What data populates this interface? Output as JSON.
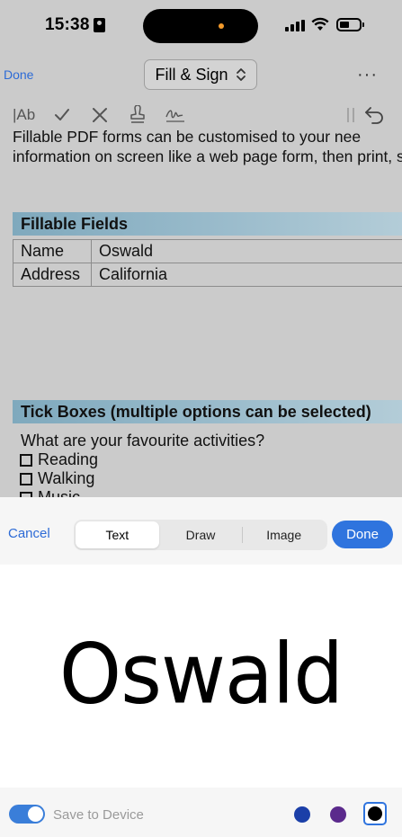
{
  "status_bar": {
    "time": "15:38"
  },
  "nav": {
    "done_label": "Done",
    "mode_label": "Fill & Sign",
    "more_label": "···"
  },
  "toolbar": {
    "text_tool_label": "|Ab"
  },
  "document": {
    "intro_line_1": "Fillable PDF forms can be customised to your nee",
    "intro_line_2": "information on screen like a web page form, then print, s",
    "fillable_header": "Fillable Fields",
    "fields": [
      {
        "label": "Name",
        "value": "Oswald"
      },
      {
        "label": "Address",
        "value": "California"
      }
    ],
    "tick_header": "Tick Boxes (multiple options can be selected)",
    "question": "What are your favourite activities?",
    "options": [
      "Reading",
      "Walking",
      "Music"
    ]
  },
  "signature_panel": {
    "cancel_label": "Cancel",
    "tabs": [
      "Text",
      "Draw",
      "Image"
    ],
    "active_tab": "Text",
    "done_label": "Done",
    "signature_text": "Oswald",
    "save_label": "Save to Device",
    "save_enabled": true,
    "colors": [
      "#1b3fa8",
      "#5b2a8c",
      "#000000"
    ],
    "selected_color": "#000000"
  }
}
